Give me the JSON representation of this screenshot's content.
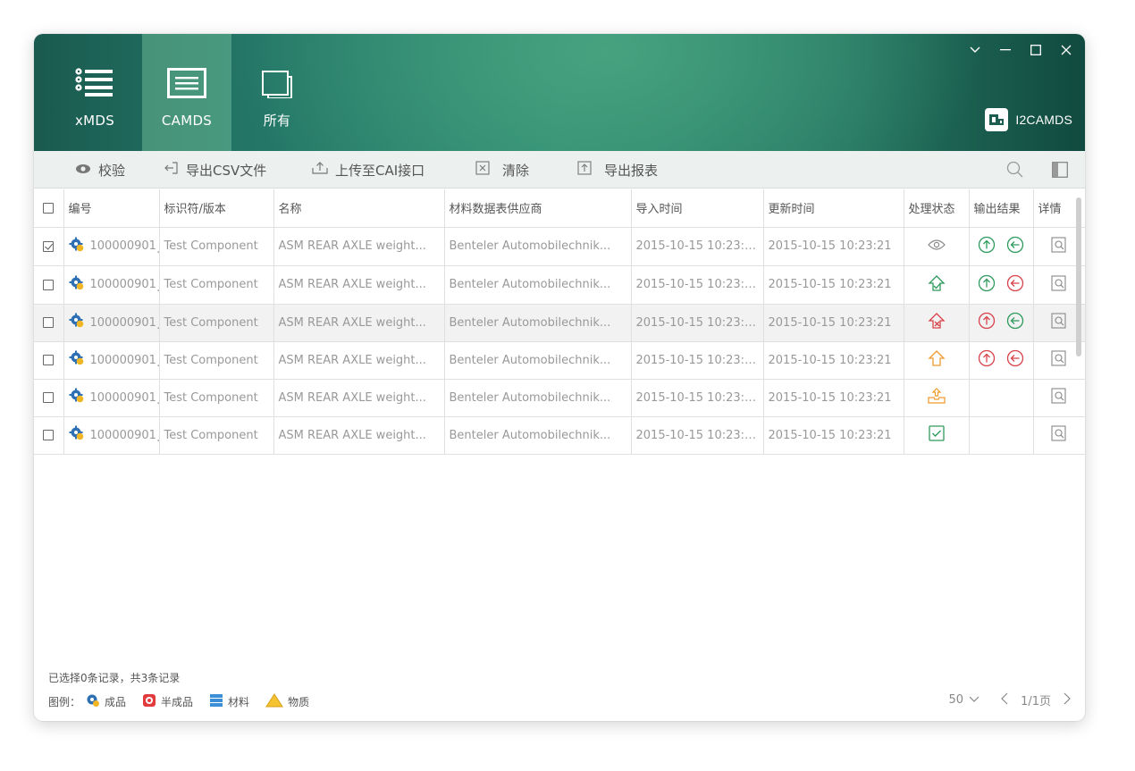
{
  "nav": {
    "tabs": [
      {
        "label": "xMDS",
        "icon": "list-icon",
        "active": false
      },
      {
        "label": "CAMDS",
        "icon": "document-icon",
        "active": true
      },
      {
        "label": "所有",
        "icon": "copy-icon",
        "active": false
      }
    ]
  },
  "brand": {
    "name": "I2CAMDS",
    "icon": "brand-logo-icon"
  },
  "window_controls": [
    "chevron-down-icon",
    "minimize-icon",
    "maximize-icon",
    "close-icon"
  ],
  "toolbar": {
    "validate": "校验",
    "export_csv": "导出CSV文件",
    "upload_cai": "上传至CAI接口",
    "clear": "清除",
    "export_report": "导出报表",
    "search_icon": "search-icon",
    "panel_icon": "panel-toggle-icon"
  },
  "table": {
    "headers": {
      "id": "编号",
      "identifier": "标识符/版本",
      "name": "名称",
      "supplier": "材料数据表供应商",
      "import_time": "导入时间",
      "update_time": "更新时间",
      "status": "处理状态",
      "result": "输出结果",
      "detail": "详情"
    },
    "rows": [
      {
        "checked": true,
        "id": "100000901",
        "identifier": "Test Component",
        "name": "ASM REAR AXLE weight...",
        "supplier": "Benteler Automobilechnik...",
        "import_time": "2015-10-15 10:23:21",
        "update_time": "2015-10-15 10:23:21",
        "status": "eye-icon",
        "results": [
          "upload-ok-icon",
          "return-ok-icon"
        ]
      },
      {
        "checked": false,
        "id": "100000901",
        "identifier": "Test Component",
        "name": "ASM REAR AXLE weight...",
        "supplier": "Benteler Automobilechnik...",
        "import_time": "2015-10-15 10:23:21",
        "update_time": "2015-10-15 10:23:21",
        "status": "upload-validated-icon",
        "results": [
          "upload-ok-icon",
          "return-error-icon"
        ]
      },
      {
        "checked": false,
        "id": "100000901",
        "identifier": "Test Component",
        "name": "ASM REAR AXLE weight...",
        "supplier": "Benteler Automobilechnik...",
        "import_time": "2015-10-15 10:23:21",
        "update_time": "2015-10-15 10:23:21",
        "status": "upload-failed-icon",
        "results": [
          "upload-error-icon",
          "return-ok-icon"
        ]
      },
      {
        "checked": false,
        "id": "100000901",
        "identifier": "Test Component",
        "name": "ASM REAR AXLE weight...",
        "supplier": "Benteler Automobilechnik...",
        "import_time": "2015-10-15 10:23:21",
        "update_time": "2015-10-15 10:23:21",
        "status": "upload-pending-icon",
        "results": [
          "upload-error-icon",
          "return-error-icon"
        ]
      },
      {
        "checked": false,
        "id": "100000901",
        "identifier": "Test Component",
        "name": "ASM REAR AXLE weight...",
        "supplier": "Benteler Automobilechnik...",
        "import_time": "2015-10-15 10:23:21",
        "update_time": "2015-10-15 10:23:21",
        "status": "processing-icon",
        "results": []
      },
      {
        "checked": false,
        "id": "100000901",
        "identifier": "Test Component",
        "name": "ASM REAR AXLE weight...",
        "supplier": "Benteler Automobilechnik...",
        "import_time": "2015-10-15 10:23:21",
        "update_time": "2015-10-15 10:23:21",
        "status": "checked-box-icon",
        "results": []
      }
    ]
  },
  "footer": {
    "selection": "已选择0条记录，共3条记录",
    "legend_label": "图例：",
    "legend": [
      {
        "label": "成品",
        "icon": "finished-product-icon"
      },
      {
        "label": "半成品",
        "icon": "semi-finished-icon"
      },
      {
        "label": "材料",
        "icon": "material-icon"
      },
      {
        "label": "物质",
        "icon": "substance-icon"
      }
    ],
    "page_size": "50",
    "page_info": "1/1页"
  },
  "colors": {
    "green": "#2e9a5c",
    "red": "#d8424b",
    "orange": "#ee9a2c",
    "header_dark": "#1a5a4f"
  }
}
